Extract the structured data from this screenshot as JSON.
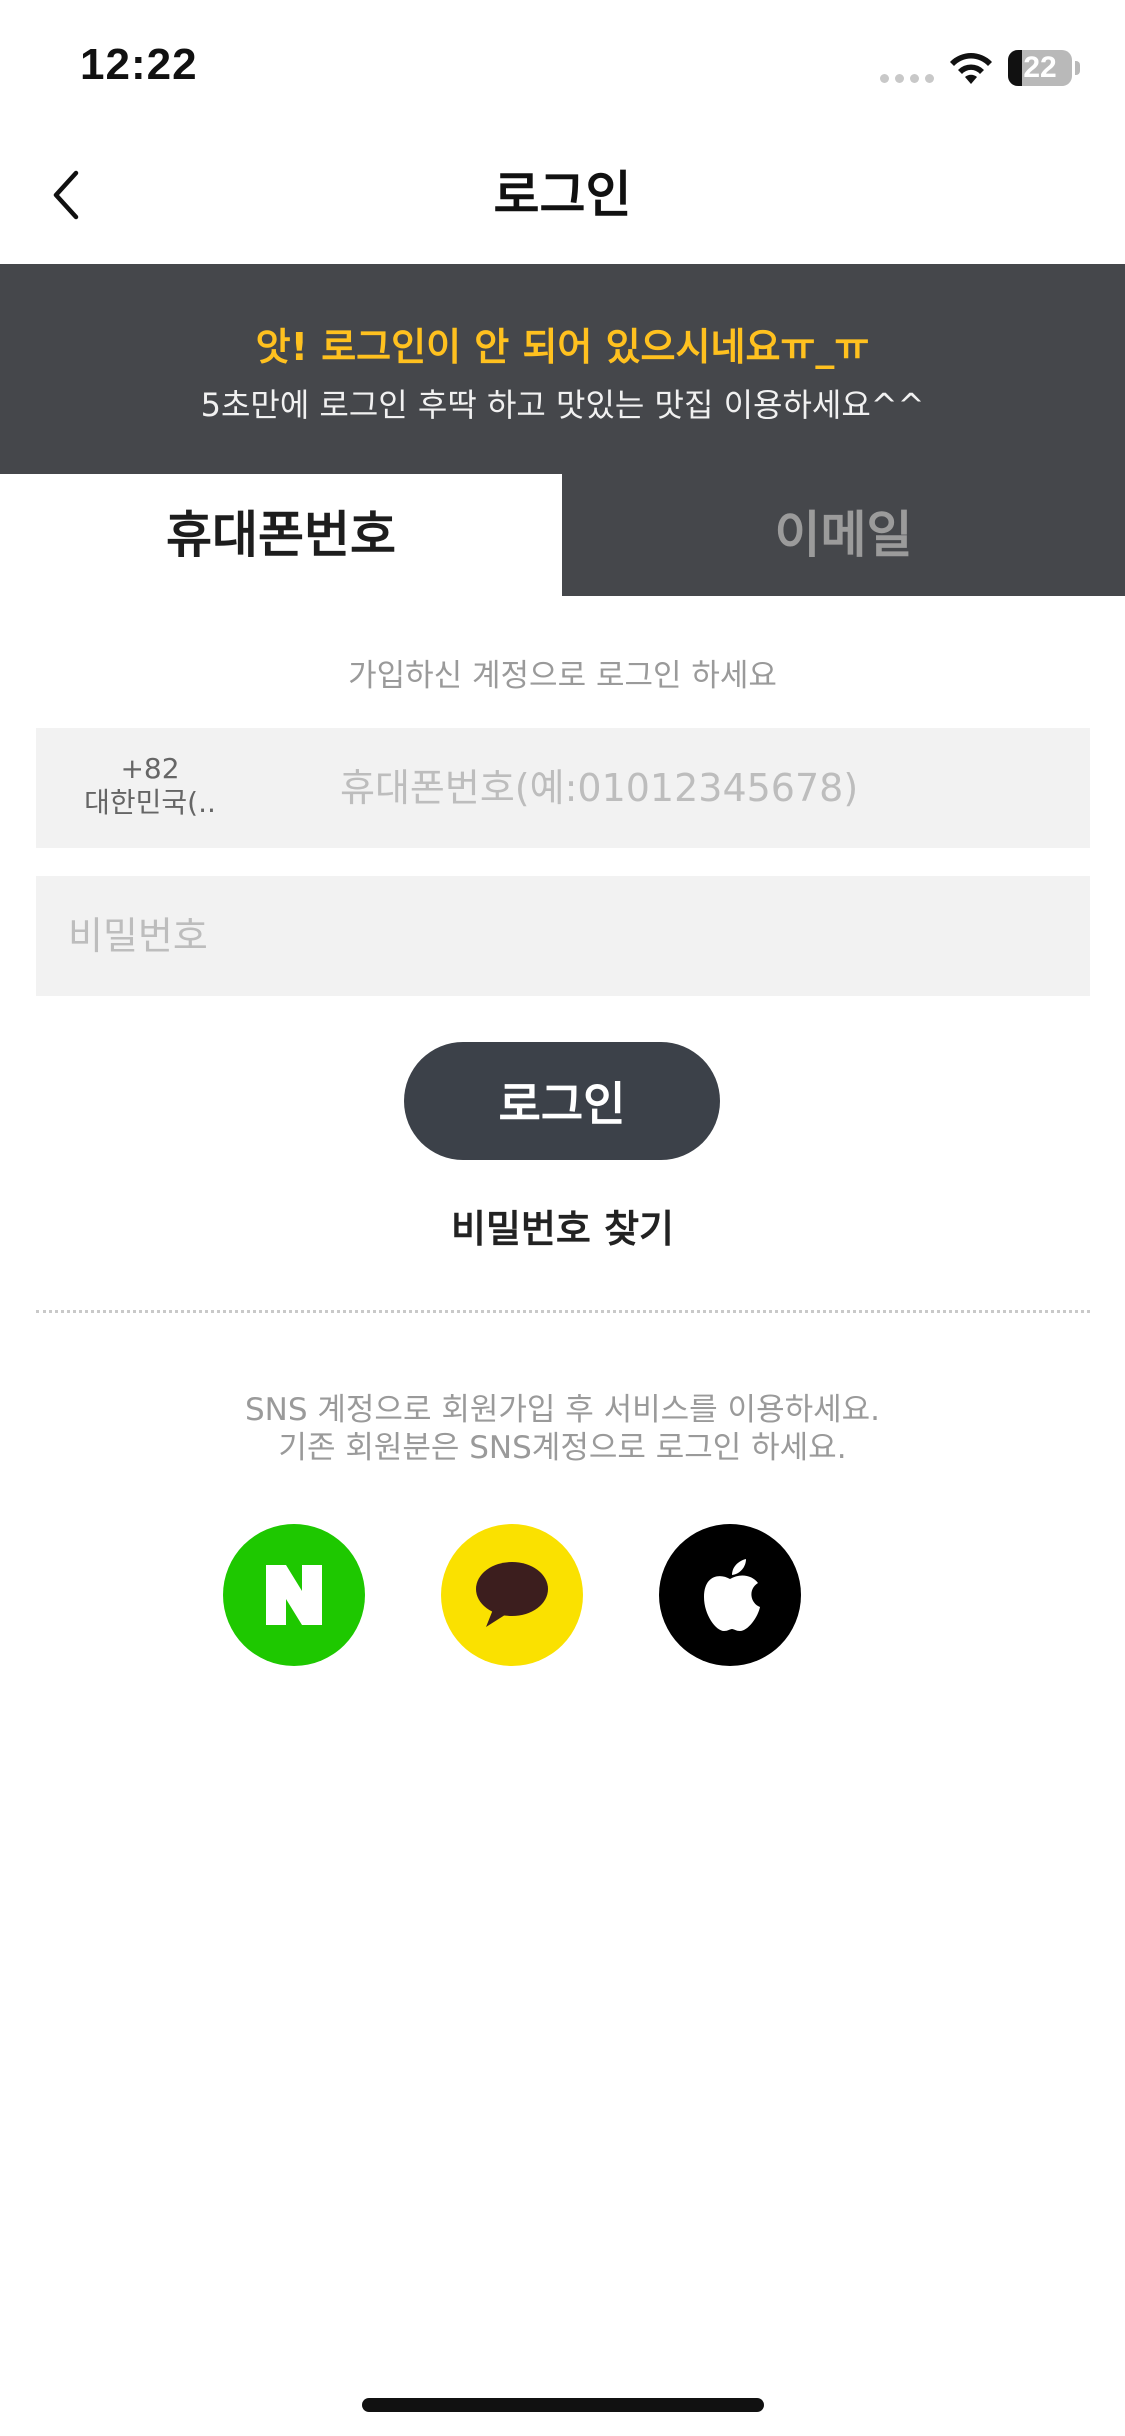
{
  "status_bar": {
    "time": "12:22",
    "battery_level": 22,
    "battery_label": "22"
  },
  "nav": {
    "title": "로그인",
    "back_icon": "chevron-left-icon"
  },
  "banner": {
    "title": "앗! 로그인이 안 되어 있으시네요ㅠ_ㅠ",
    "subtitle": "5초만에 로그인 후딱 하고 맛있는 맛집 이용하세요^^",
    "background": "#45474b",
    "title_color": "#ffc11f"
  },
  "tabs": [
    {
      "label": "휴대폰번호",
      "active": true
    },
    {
      "label": "이메일",
      "active": false
    }
  ],
  "form": {
    "hint": "가입하신 계정으로 로그인 하세요",
    "country_code": "+82",
    "country_name": "대한민국(..",
    "phone_placeholder": "휴대폰번호(예:01012345678)",
    "password_placeholder": "비밀번호",
    "login_label": "로그인",
    "find_password": "비밀번호 찾기"
  },
  "sns": {
    "line1": "SNS 계정으로 회원가입 후 서비스를 이용하세요.",
    "line2": "기존 회원분은 SNS계정으로 로그인 하세요.",
    "providers": [
      {
        "name": "naver",
        "icon": "naver-n-icon",
        "color": "#1ec800"
      },
      {
        "name": "kakao",
        "icon": "kakao-talk-icon",
        "color": "#fae100"
      },
      {
        "name": "apple",
        "icon": "apple-icon",
        "color": "#000000"
      }
    ]
  }
}
